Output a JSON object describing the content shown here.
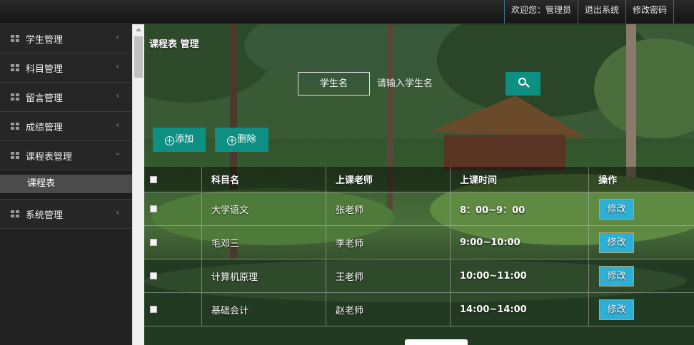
{
  "topbar": {
    "welcome": "欢迎您：管理员",
    "logout": "退出系统",
    "change_password": "修改密码"
  },
  "sidebar": {
    "items": [
      {
        "label": "学生管理"
      },
      {
        "label": "科目管理"
      },
      {
        "label": "留言管理"
      },
      {
        "label": "成绩管理"
      },
      {
        "label": "课程表管理",
        "sub": [
          "课程表"
        ]
      },
      {
        "label": "系统管理"
      }
    ]
  },
  "icons": {
    "menu": "grid-icon",
    "collapsed": "chevron-left-icon",
    "expanded": "chevron-down-icon",
    "search": "search-icon",
    "add": "plus-circle-icon"
  },
  "colors": {
    "accent": "#0e8f84",
    "edit_button": "#2eb0d6"
  },
  "main": {
    "title": "课程表 管理",
    "search": {
      "label": "学生名",
      "placeholder": "请输入学生名",
      "value": ""
    },
    "actions": {
      "add": "添加",
      "delete": "删除"
    },
    "table": {
      "headers": [
        "科目名",
        "上课老师",
        "上课时间",
        "操作"
      ],
      "rows": [
        {
          "subject": "大学语文",
          "teacher": "张老师",
          "time": "8：00~9：00",
          "action": "修改"
        },
        {
          "subject": "毛邓三",
          "teacher": "李老师",
          "time": "9:00~10:00",
          "action": "修改"
        },
        {
          "subject": "计算机原理",
          "teacher": "王老师",
          "time": "10:00~11:00",
          "action": "修改"
        },
        {
          "subject": "基础会计",
          "teacher": "赵老师",
          "time": "14:00~14:00",
          "action": "修改"
        }
      ]
    }
  }
}
